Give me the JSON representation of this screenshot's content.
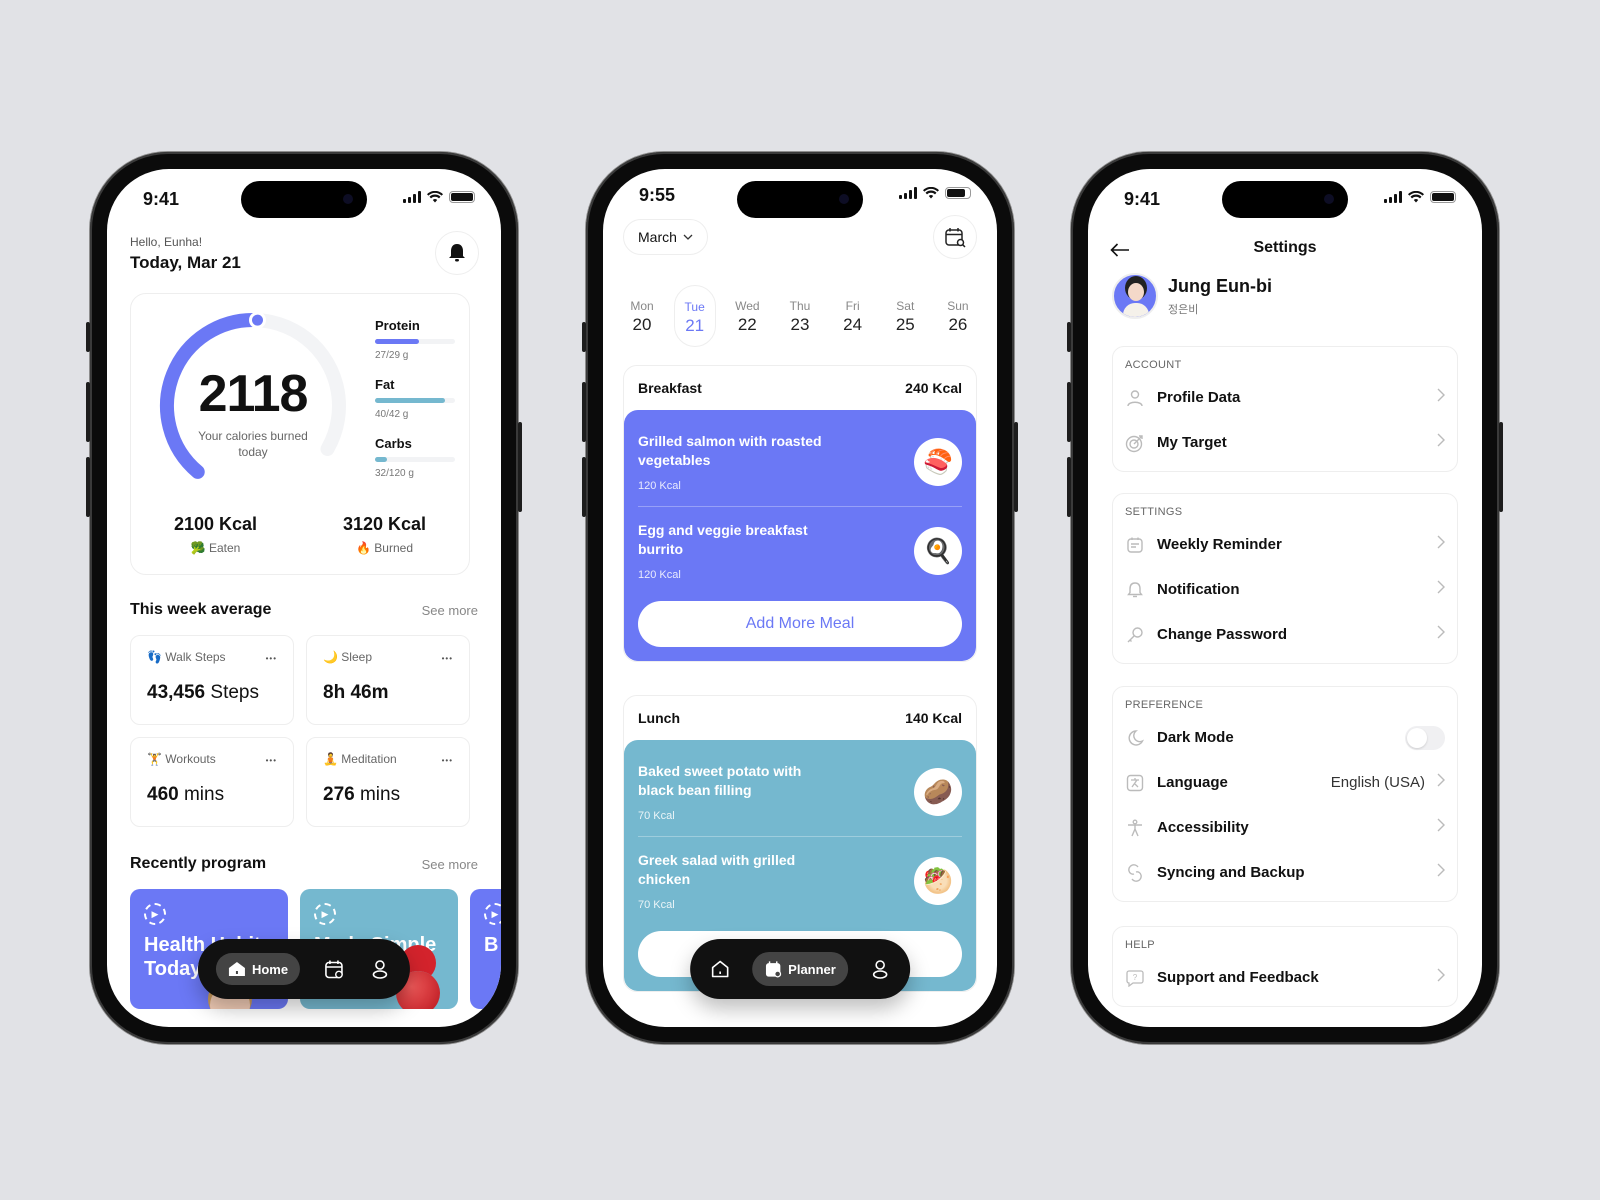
{
  "colors": {
    "accent": "#6b78f5",
    "teal": "#75b8cf",
    "background": "#e1e2e6"
  },
  "home": {
    "status_time": "9:41",
    "greeting": "Hello, Eunha!",
    "date": "Today, Mar 21",
    "calories": {
      "value": "2118",
      "caption": "Your calories burned today",
      "progress_fraction": 0.55,
      "eaten": {
        "value": "2100 Kcal",
        "label": "Eaten",
        "icon": "🥦"
      },
      "burned": {
        "value": "3120 Kcal",
        "label": "Burned",
        "icon": "🔥"
      }
    },
    "macros": [
      {
        "name": "Protein",
        "value": "27/29 g",
        "fraction": 0.55,
        "color": "#6b78f5"
      },
      {
        "name": "Fat",
        "value": "40/42 g",
        "fraction": 0.88,
        "color": "#75b8cf"
      },
      {
        "name": "Carbs",
        "value": "32/120 g",
        "fraction": 0.15,
        "color": "#75b8cf"
      }
    ],
    "week_section": {
      "title": "This week average",
      "see_more": "See more"
    },
    "stats": [
      {
        "icon": "👣",
        "label": "Walk Steps",
        "value": "43,456",
        "unit": "Steps"
      },
      {
        "icon": "🌙",
        "label": "Sleep",
        "value": "8h 46m",
        "unit": ""
      },
      {
        "icon": "🏋",
        "label": "Workouts",
        "value": "460",
        "unit": "mins"
      },
      {
        "icon": "🧘",
        "label": "Meditation",
        "value": "276",
        "unit": "mins"
      }
    ],
    "program_section": {
      "title": "Recently program",
      "see_more": "See more"
    },
    "programs": [
      {
        "title": "Health Habits Today",
        "color": "#6b78f5"
      },
      {
        "title": "Made Simple",
        "color": "#75b8cf"
      },
      {
        "title": "B",
        "color": "#6b78f5"
      }
    ],
    "nav": {
      "active_label": "Home"
    }
  },
  "planner": {
    "status_time": "9:55",
    "month": "March",
    "week": [
      {
        "name": "Mon",
        "date": "20"
      },
      {
        "name": "Tue",
        "date": "21",
        "active": true
      },
      {
        "name": "Wed",
        "date": "22"
      },
      {
        "name": "Thu",
        "date": "23"
      },
      {
        "name": "Fri",
        "date": "24"
      },
      {
        "name": "Sat",
        "date": "25"
      },
      {
        "name": "Sun",
        "date": "26"
      }
    ],
    "meals": [
      {
        "name": "Breakfast",
        "kcal": "240 Kcal",
        "items": [
          {
            "name": "Grilled salmon with roasted vegetables",
            "kcal": "120 Kcal",
            "emoji": "🍣"
          },
          {
            "name": "Egg and veggie breakfast burrito",
            "kcal": "120 Kcal",
            "emoji": "🍳"
          }
        ],
        "add_label": "Add More Meal"
      },
      {
        "name": "Lunch",
        "kcal": "140 Kcal",
        "items": [
          {
            "name": "Baked sweet potato with black bean filling",
            "kcal": "70 Kcal",
            "emoji": "🥔"
          },
          {
            "name": "Greek salad with grilled chicken",
            "kcal": "70 Kcal",
            "emoji": "🥙"
          }
        ],
        "add_label": "Add More Meal"
      }
    ],
    "nav": {
      "active_label": "Planner"
    }
  },
  "settings": {
    "status_time": "9:41",
    "title": "Settings",
    "profile": {
      "name": "Jung Eun-bi",
      "korean_name": "정은비"
    },
    "groups": [
      {
        "header": "ACCOUNT",
        "items": [
          {
            "label": "Profile Data",
            "icon": "user-icon"
          },
          {
            "label": "My Target",
            "icon": "target-icon"
          }
        ]
      },
      {
        "header": "SETTINGS",
        "items": [
          {
            "label": "Weekly Reminder",
            "icon": "reminder-icon"
          },
          {
            "label": "Notification",
            "icon": "bell-icon"
          },
          {
            "label": "Change Password",
            "icon": "key-icon"
          }
        ]
      },
      {
        "header": "PREFERENCE",
        "items": [
          {
            "label": "Dark Mode",
            "icon": "moon-icon",
            "toggle": false
          },
          {
            "label": "Language",
            "icon": "language-icon",
            "value": "English (USA)"
          },
          {
            "label": "Accessibility",
            "icon": "accessibility-icon"
          },
          {
            "label": "Syncing and Backup",
            "icon": "sync-icon"
          }
        ]
      },
      {
        "header": "HELP",
        "items": [
          {
            "label": "Support and Feedback",
            "icon": "support-icon"
          }
        ]
      }
    ]
  }
}
